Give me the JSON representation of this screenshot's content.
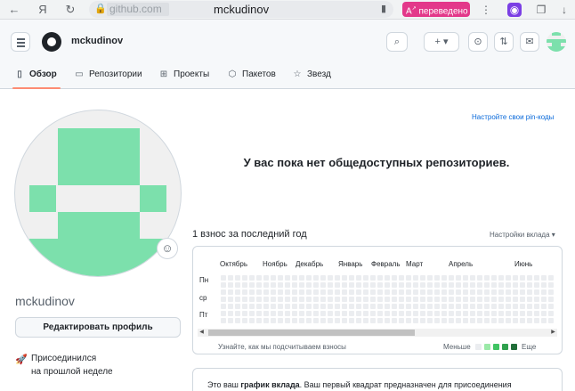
{
  "browser": {
    "back_icon": "arrow-left-icon",
    "yandex_icon": "yandex-icon",
    "reload_icon": "reload-icon",
    "host": "github.com",
    "path": "mckudinov",
    "translate_label": "переведено"
  },
  "header": {
    "username": "mckudinov",
    "new_button": "+ ▾"
  },
  "tabs": [
    {
      "label": "Обзор"
    },
    {
      "label": "Репозитории"
    },
    {
      "label": "Проекты"
    },
    {
      "label": "Пакетов"
    },
    {
      "label": "Звезд"
    }
  ],
  "profile": {
    "login": "mckudinov",
    "edit_label": "Редактировать профиль",
    "joined_line1": "Присоединился",
    "joined_line2": "на прошлой неделе"
  },
  "main": {
    "pin_link": "Настройте свои pin-коды",
    "no_repos": "У вас пока нет общедоступных репозиториев.",
    "contrib_title": "1 взнос за последний год",
    "contrib_settings": "Настройки вклада ▾",
    "months": [
      "Октябрь",
      "Ноябрь",
      "Декабрь",
      "Январь",
      "Февраль",
      "Март",
      "Апрель",
      "Июнь"
    ],
    "days": [
      "Пн",
      "ср",
      "Пт"
    ],
    "learn_link": "Узнайте, как мы подсчитываем взносы",
    "legend_less": "Меньше",
    "legend_more": "Еще",
    "legend_colors": [
      "#ebedf0",
      "#9be9a8",
      "#40c463",
      "#30a14e",
      "#216e39"
    ],
    "desc_pre": "Это ваш ",
    "desc_bold": "график вклада",
    "desc_post": ". Ваш первый квадрат предназначен для присоединения"
  }
}
